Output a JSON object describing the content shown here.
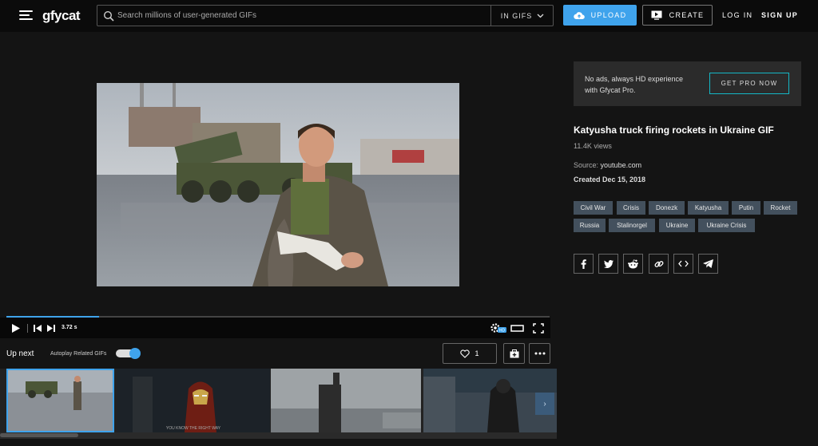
{
  "header": {
    "logo": "gfycat",
    "search_placeholder": "Search millions of user-generated GIFs",
    "search_scope": "IN GIFS",
    "upload_label": "UPLOAD",
    "create_label": "CREATE",
    "login_label": "LOG IN",
    "signup_label": "SIGN UP",
    "accent_color": "#3fa3ec"
  },
  "player": {
    "time": "3.72 s",
    "progress": 0.17,
    "badge": "HD"
  },
  "upnext": {
    "label": "Up next",
    "autoplay_label": "Autoplay Related GIFs",
    "autoplay_on": true,
    "like_count": "1",
    "thumbnails": [
      "Katyusha truck firing rockets",
      "Iron Man",
      "Soldier with raised arm",
      "Armored figure"
    ],
    "thumb2_caption": "YOU KNOW THE RIGHT WAY"
  },
  "sidebar": {
    "pro_text": "No ads, always HD experience with Gfycat Pro.",
    "pro_button": "GET PRO NOW",
    "title": "Katyusha truck firing rockets in Ukraine GIF",
    "views": "11.4K views",
    "source_label": "Source:",
    "source_value": "youtube.com",
    "created": "Created Dec 15, 2018",
    "tags": [
      "Civil War",
      "Crisis",
      "Donezk",
      "Katyusha",
      "Putin",
      "Rocket",
      "Russia",
      "Stalinorgel",
      "Ukraine",
      "Ukraine Crisis"
    ],
    "share_icons": [
      "facebook-icon",
      "twitter-icon",
      "reddit-icon",
      "link-icon",
      "embed-icon",
      "telegram-icon"
    ]
  }
}
